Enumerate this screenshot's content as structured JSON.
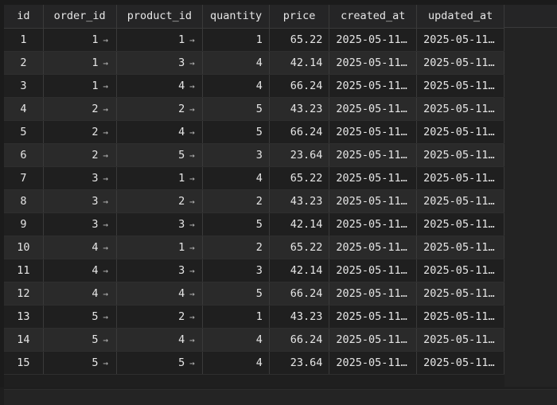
{
  "columns": [
    "id",
    "order_id",
    "product_id",
    "quantity",
    "price",
    "created_at",
    "updated_at"
  ],
  "rows": [
    {
      "id": "1",
      "order_id": "1",
      "product_id": "1",
      "quantity": "1",
      "price": "65.22",
      "created_at": "2025-05-11…",
      "updated_at": "2025-05-11…"
    },
    {
      "id": "2",
      "order_id": "1",
      "product_id": "3",
      "quantity": "4",
      "price": "42.14",
      "created_at": "2025-05-11…",
      "updated_at": "2025-05-11…"
    },
    {
      "id": "3",
      "order_id": "1",
      "product_id": "4",
      "quantity": "4",
      "price": "66.24",
      "created_at": "2025-05-11…",
      "updated_at": "2025-05-11…"
    },
    {
      "id": "4",
      "order_id": "2",
      "product_id": "2",
      "quantity": "5",
      "price": "43.23",
      "created_at": "2025-05-11…",
      "updated_at": "2025-05-11…"
    },
    {
      "id": "5",
      "order_id": "2",
      "product_id": "4",
      "quantity": "5",
      "price": "66.24",
      "created_at": "2025-05-11…",
      "updated_at": "2025-05-11…"
    },
    {
      "id": "6",
      "order_id": "2",
      "product_id": "5",
      "quantity": "3",
      "price": "23.64",
      "created_at": "2025-05-11…",
      "updated_at": "2025-05-11…"
    },
    {
      "id": "7",
      "order_id": "3",
      "product_id": "1",
      "quantity": "4",
      "price": "65.22",
      "created_at": "2025-05-11…",
      "updated_at": "2025-05-11…"
    },
    {
      "id": "8",
      "order_id": "3",
      "product_id": "2",
      "quantity": "2",
      "price": "43.23",
      "created_at": "2025-05-11…",
      "updated_at": "2025-05-11…"
    },
    {
      "id": "9",
      "order_id": "3",
      "product_id": "3",
      "quantity": "5",
      "price": "42.14",
      "created_at": "2025-05-11…",
      "updated_at": "2025-05-11…"
    },
    {
      "id": "10",
      "order_id": "4",
      "product_id": "1",
      "quantity": "2",
      "price": "65.22",
      "created_at": "2025-05-11…",
      "updated_at": "2025-05-11…"
    },
    {
      "id": "11",
      "order_id": "4",
      "product_id": "3",
      "quantity": "3",
      "price": "42.14",
      "created_at": "2025-05-11…",
      "updated_at": "2025-05-11…"
    },
    {
      "id": "12",
      "order_id": "4",
      "product_id": "4",
      "quantity": "5",
      "price": "66.24",
      "created_at": "2025-05-11…",
      "updated_at": "2025-05-11…"
    },
    {
      "id": "13",
      "order_id": "5",
      "product_id": "2",
      "quantity": "1",
      "price": "43.23",
      "created_at": "2025-05-11…",
      "updated_at": "2025-05-11…"
    },
    {
      "id": "14",
      "order_id": "5",
      "product_id": "4",
      "quantity": "4",
      "price": "66.24",
      "created_at": "2025-05-11…",
      "updated_at": "2025-05-11…"
    },
    {
      "id": "15",
      "order_id": "5",
      "product_id": "5",
      "quantity": "4",
      "price": "23.64",
      "created_at": "2025-05-11…",
      "updated_at": "2025-05-11…"
    }
  ],
  "fk_columns": [
    "order_id",
    "product_id"
  ],
  "fk_icon": "arrow-right-icon",
  "colors": {
    "background": "#1f1f1f",
    "row_alt": "#2a2a2a",
    "header_bg": "#252526",
    "text": "#e6e6e6"
  }
}
